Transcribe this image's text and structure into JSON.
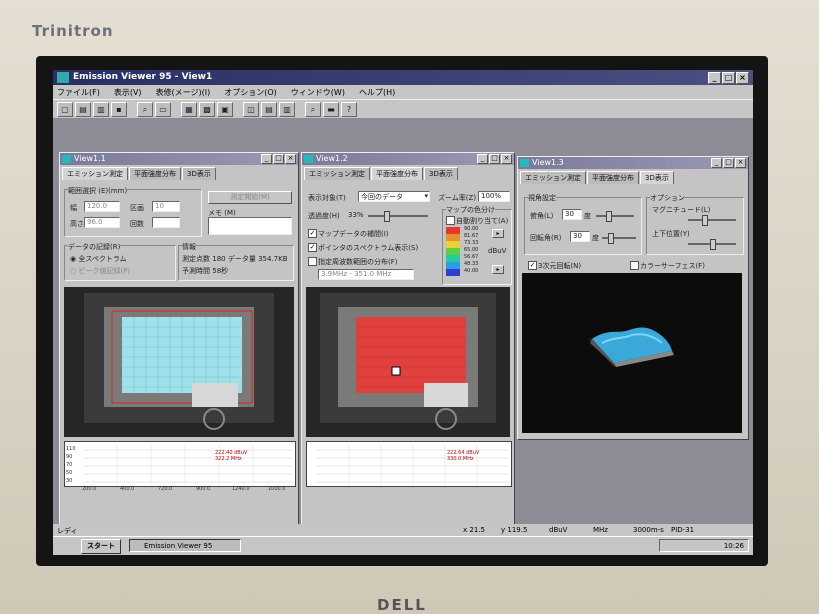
{
  "monitor": {
    "brand": "Trinitron",
    "maker": "DELL"
  },
  "app": {
    "title": "Emission Viewer 95 - View1",
    "menus": [
      "ファイル(F)",
      "表示(V)",
      "表修(メージ)(I)",
      "オプション(O)",
      "ウィンドウ(W)",
      "ヘルプ(H)"
    ],
    "window_buttons": [
      "_",
      "□",
      "×"
    ]
  },
  "view1": {
    "title": "View1.1",
    "tabs": [
      "エミッション測定",
      "平面強度分布",
      "3D表示"
    ],
    "range_group": "範囲選択 (E)(mm)",
    "width_label": "幅",
    "width_value": "120.0",
    "div_label": "区画",
    "div_value": "10",
    "height_label": "高さ",
    "height_value": "96.0",
    "times_label": "回数",
    "measure_button": "測定開始(M)",
    "memo_label": "メモ (M)",
    "record_group": "データの記録(R)",
    "radio_all": "全スペクトラム",
    "radio_peak": "ピーク値記録(P)",
    "info_group": "情報",
    "points_label": "測定点数",
    "points_value": "180",
    "data_label": "データ量",
    "data_value": "354.7KB",
    "time_label": "予測時間",
    "time_value": "58秒",
    "graph_y_ticks": [
      "110",
      "90",
      "70",
      "50",
      "30"
    ],
    "graph_x_ticks": [
      "200.0",
      "400.0",
      "720.0",
      "900.0",
      "1240.0",
      "1000.0"
    ],
    "graph_readout": [
      "222.40 dBuV",
      "322.2 MHz"
    ]
  },
  "view2": {
    "title": "View1.2",
    "tabs": [
      "エミッション測定",
      "平面強度分布",
      "3D表示"
    ],
    "target_label": "表示対象(T)",
    "target_value": "今回のデータ",
    "zoom_label": "ズーム率(Z)",
    "zoom_value": "100%",
    "opacity_label": "透過度(H)",
    "opacity_value": "33%",
    "map_color_group": "マップの色分け",
    "auto_assign": "自動割り当て(A)",
    "checks": [
      "マップデータの補間(I)",
      "ポインタのスペクトラム表示(S)",
      "指定周波数範囲の分布(F)"
    ],
    "freq_field": "3.9MHz - 351.0 MHz",
    "legend_values": [
      "90.00",
      "81.67",
      "73.33",
      "65.00",
      "56.67",
      "48.33",
      "40.00"
    ],
    "legend_unit": "dBuV",
    "legend_colors": [
      "#e23a2a",
      "#e89030",
      "#e8d038",
      "#5fd040",
      "#28c8a0",
      "#2aa0e0",
      "#2a40d0"
    ],
    "graph_readout": [
      "222.64 dBuV",
      "330.0 MHz"
    ]
  },
  "view3": {
    "title": "View1.3",
    "tabs": [
      "エミッション測定",
      "平面強度分布",
      "3D表示"
    ],
    "viewpoint_group": "視角設定",
    "deg1_label": "俯角(L)",
    "deg1_value": "30",
    "deg_unit": "度",
    "deg2_label": "回転角(R)",
    "deg2_value": "30",
    "options_group": "オプション",
    "magnitude_label": "マグニチュード(L)",
    "updown_label": "上下位置(Y)",
    "wire_check": "3次元回転(N)",
    "color_surface": "カラーサーフェス(F)"
  },
  "statusbar": {
    "ready": "レディ",
    "x": "x 21.5",
    "y": "y 119.5",
    "unit1": "dBuV",
    "unit2": "MHz",
    "unit3": "3000m-s",
    "code": "PID-31"
  },
  "taskbar": {
    "start": "スタート",
    "task": "Emission Viewer 95",
    "clock": "10:26"
  }
}
